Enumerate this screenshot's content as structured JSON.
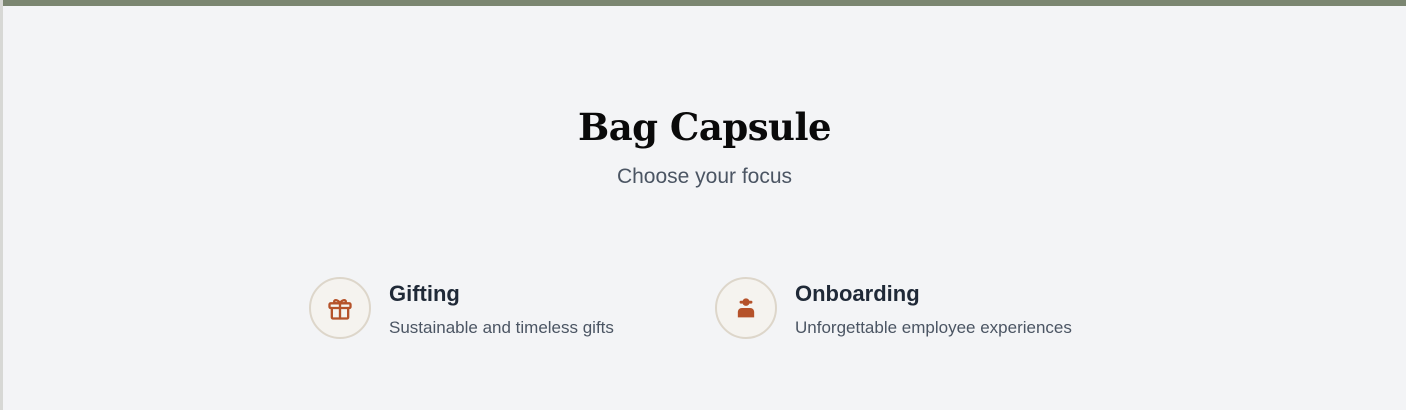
{
  "header": {
    "title": "Bag Capsule",
    "subtitle": "Choose your focus"
  },
  "options": [
    {
      "title": "Gifting",
      "description": "Sustainable and timeless gifts",
      "icon": "gift-icon"
    },
    {
      "title": "Onboarding",
      "description": "Unforgettable employee experiences",
      "icon": "employee-icon"
    }
  ],
  "colors": {
    "top_bar": "#7b8671",
    "icon_accent": "#b5522a",
    "background": "#f3f4f6"
  }
}
